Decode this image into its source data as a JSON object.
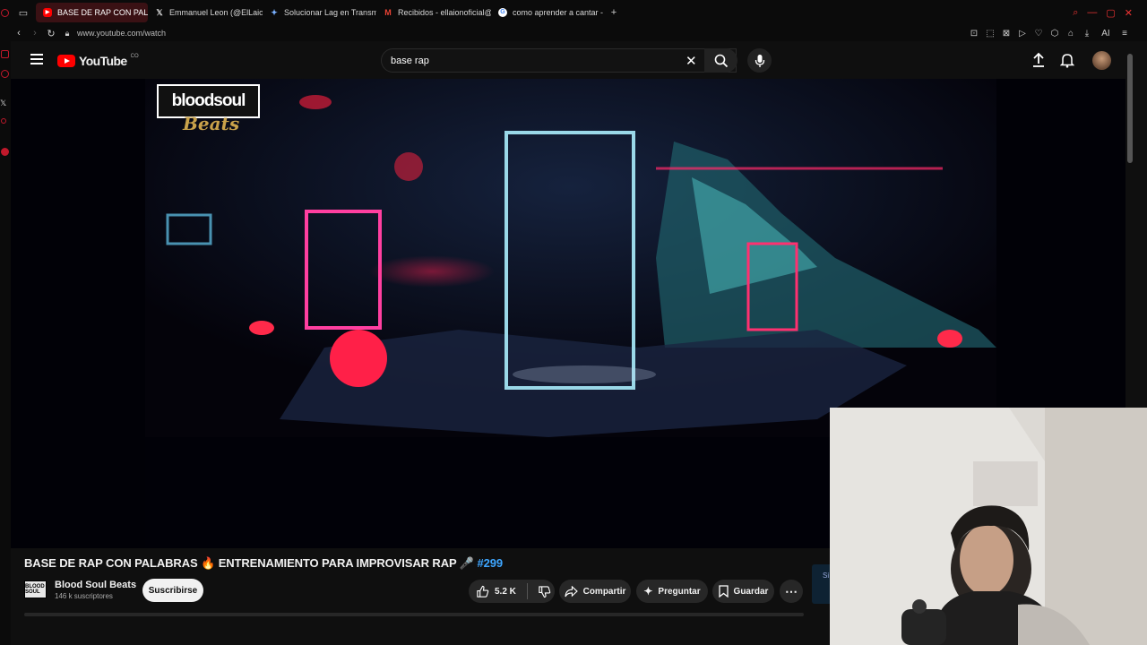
{
  "browser": {
    "tabs": [
      {
        "label": "BASE DE RAP CON PAL",
        "icon": "youtube-icon",
        "active": true
      },
      {
        "label": "Emmanuel Leon (@ElLaion",
        "icon": "x-icon",
        "active": false
      },
      {
        "label": "Solucionar Lag en Transmi",
        "icon": "sparkle-icon",
        "active": false
      },
      {
        "label": "Recibidos - ellaionoficial@",
        "icon": "gmail-icon",
        "active": false
      },
      {
        "label": "como aprender a cantar - B",
        "icon": "google-icon",
        "active": false
      }
    ],
    "new_tab": "+",
    "url": "www.youtube.com/watch",
    "ai_label": "AI"
  },
  "youtube": {
    "logo_text": "YouTube",
    "country": "CO",
    "search_value": "base rap"
  },
  "video": {
    "watermark_line1": "bloodsoul",
    "watermark_line2": "Beats",
    "title": "BASE DE RAP CON PALABRAS 🔥 ENTRENAMIENTO PARA IMPROVISAR RAP 🎤",
    "hashtag": "#299",
    "channel_avatar": "BLOOD SOUL",
    "channel_name": "Blood Soul Beats",
    "subscribers": "146 k suscriptores",
    "subscribe_label": "Suscribirse",
    "likes": "5.2 K",
    "share_label": "Compartir",
    "ask_label": "Preguntar",
    "save_label": "Guardar",
    "side_panel_text": "Si"
  },
  "colors": {
    "accent": "#ff0000",
    "link": "#3ea6ff",
    "tab_active": "#3a1114"
  }
}
